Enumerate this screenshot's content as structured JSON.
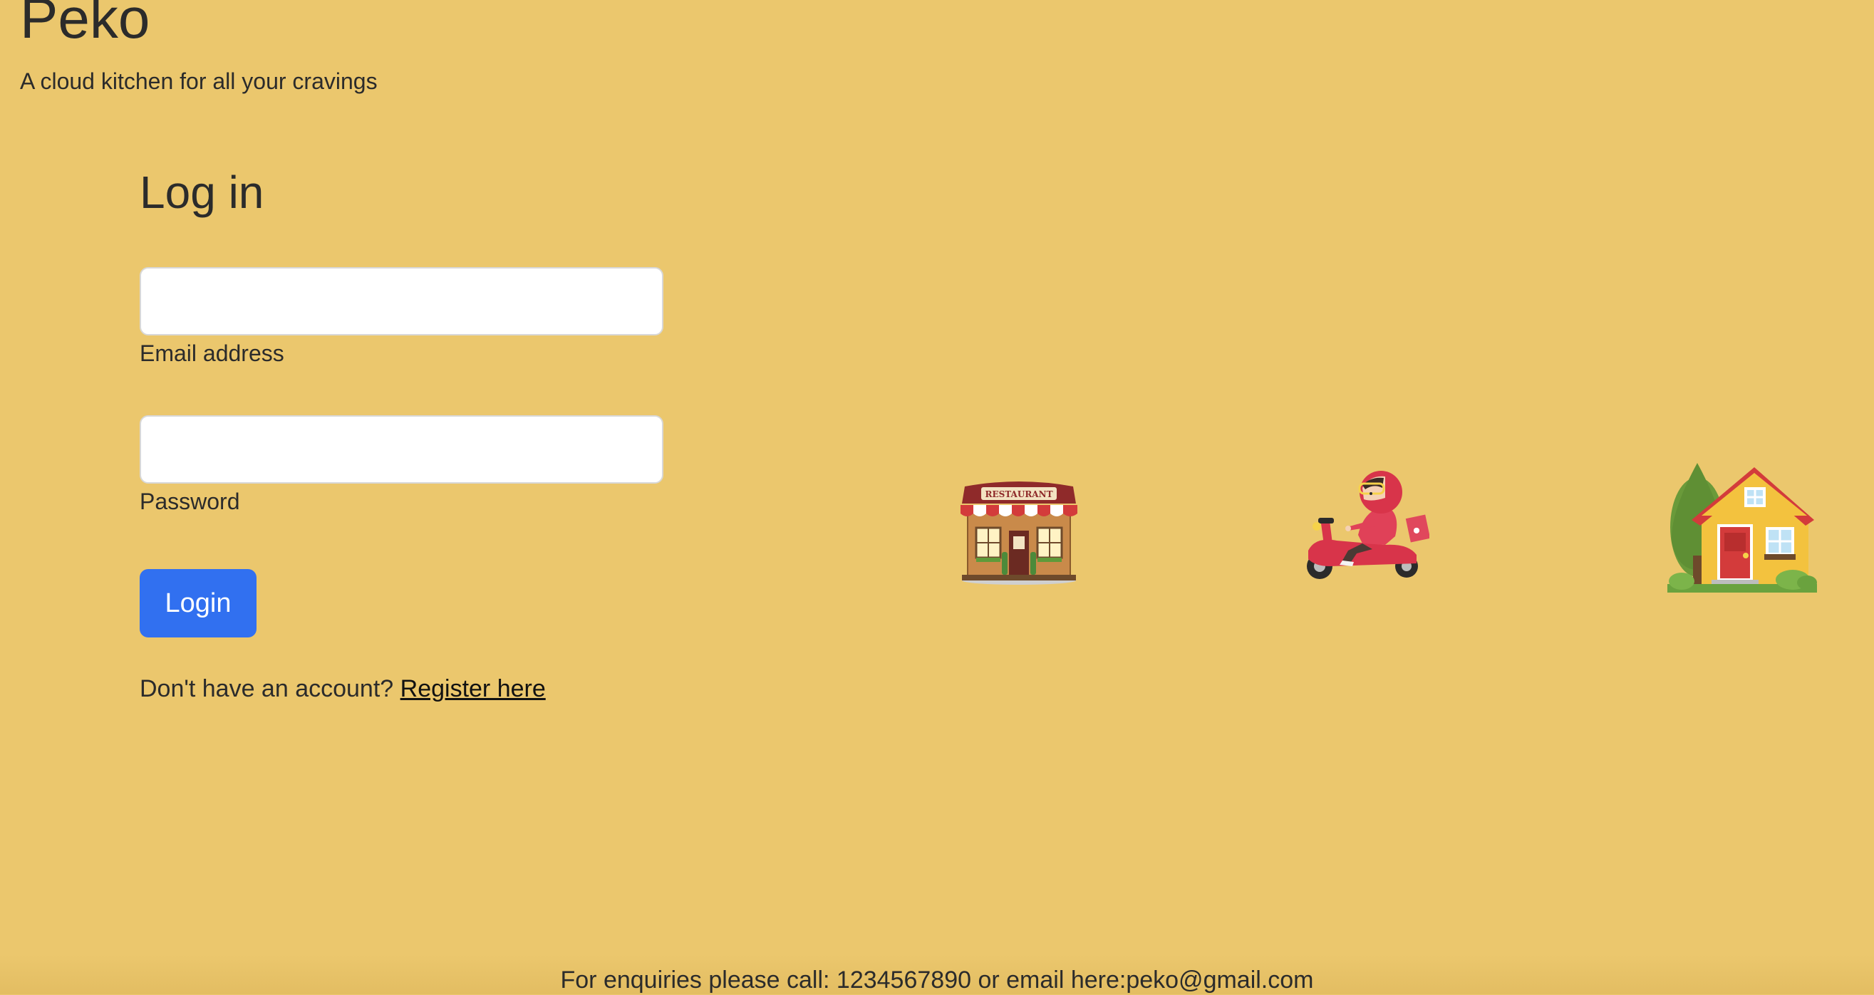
{
  "header": {
    "brand": "Peko",
    "tagline": "A cloud kitchen for all your cravings"
  },
  "login_form": {
    "heading": "Log in",
    "email": {
      "label": "Email address",
      "value": "",
      "placeholder": ""
    },
    "password": {
      "label": "Password",
      "value": "",
      "placeholder": ""
    },
    "submit_label": "Login",
    "register_prompt": "Don't have an account?",
    "register_link": "Register here"
  },
  "illustrations": [
    {
      "icon": "restaurant-icon",
      "sign_text": "RESTAURANT"
    },
    {
      "icon": "delivery-scooter-icon"
    },
    {
      "icon": "house-icon"
    }
  ],
  "footer": {
    "text": "For enquiries please call: 1234567890 or email here:peko@gmail.com"
  },
  "colors": {
    "background": "#ebc76d",
    "primary_button": "#3170f0",
    "text": "#2b2b2b"
  }
}
